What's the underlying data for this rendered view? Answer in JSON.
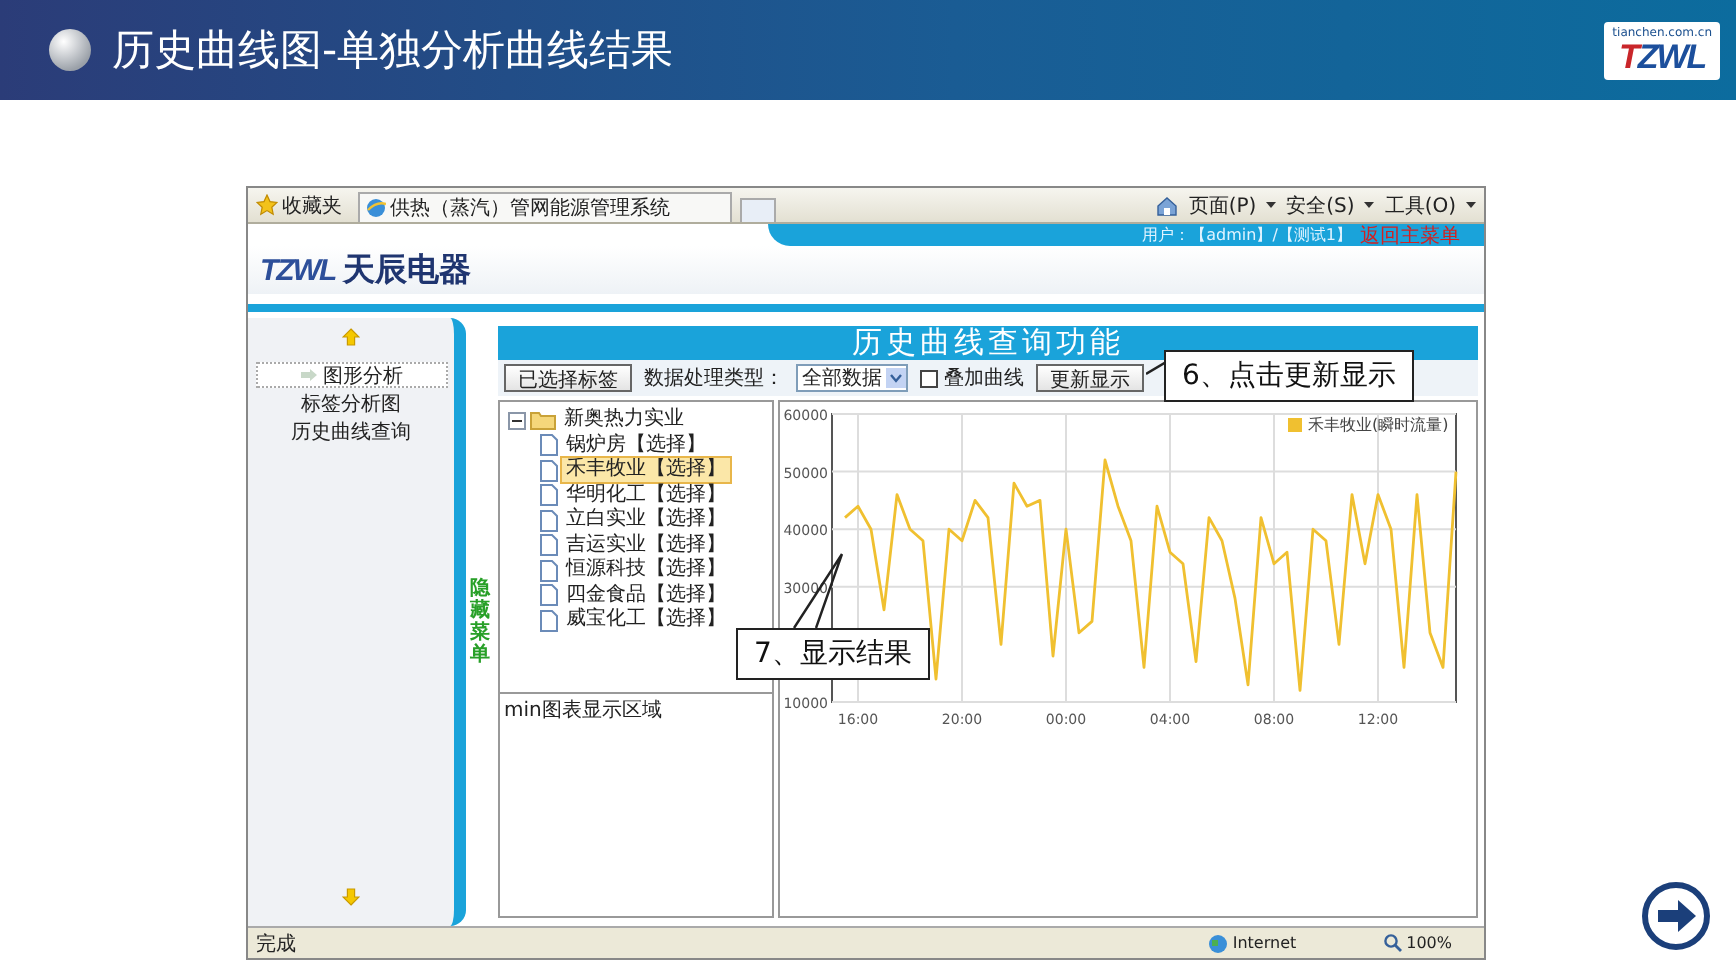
{
  "slide": {
    "title": "历史曲线图-单独分析曲线结果",
    "logo": "TZWL",
    "logo_site": "tianchen.com.cn"
  },
  "browser": {
    "favorites": "收藏夹",
    "tab_title": "供热（蒸汽）管网能源管理系统",
    "menus": [
      "页面(P)",
      "安全(S)",
      "工具(O)"
    ],
    "status": "完成",
    "zone": "Internet",
    "zoom": "100%"
  },
  "app": {
    "logo_mark": "TZWL",
    "brand": "天辰电器",
    "user": "用户：【admin】/【测试1】",
    "return_link": "返回主菜单",
    "sidebar": {
      "items": [
        {
          "label": "图形分析",
          "selected": true
        },
        {
          "label": "标签分析图",
          "selected": false
        },
        {
          "label": "历史曲线查询",
          "selected": false
        }
      ],
      "hide_menu": "隐藏菜单"
    },
    "panel_title": "历史曲线查询功能",
    "toolbar": {
      "tag_button": "已选择标签",
      "type_label": "数据处理类型：",
      "type_value": "全部数据",
      "overlay": {
        "label": "叠加曲线",
        "checked": false
      },
      "update_button": "更新显示"
    },
    "tree": {
      "label": "新奥热力实业",
      "expanded": true,
      "children": [
        {
          "label": "锅炉房【选择】",
          "selected": false
        },
        {
          "label": "禾丰牧业【选择】",
          "selected": true
        },
        {
          "label": "华明化工【选择】",
          "selected": false
        },
        {
          "label": "立白实业【选择】",
          "selected": false
        },
        {
          "label": "吉运实业【选择】",
          "selected": false
        },
        {
          "label": "恒源科技【选择】",
          "selected": false
        },
        {
          "label": "四金食品【选择】",
          "selected": false
        },
        {
          "label": "威宝化工【选择】",
          "selected": false
        }
      ]
    },
    "mini_area": "min图表显示区域",
    "chart": {
      "chart_data": {
        "type": "line",
        "categories": [
          null,
          null,
          "16:00",
          null,
          null,
          null,
          null,
          null,
          null,
          null,
          "20:00",
          null,
          null,
          null,
          null,
          null,
          null,
          null,
          "00:00",
          null,
          null,
          null,
          null,
          null,
          null,
          null,
          "04:00",
          null,
          null,
          null,
          null,
          null,
          null,
          null,
          "08:00",
          null,
          null,
          null,
          null,
          null,
          null,
          null,
          "12:00",
          null,
          null,
          null,
          null,
          null,
          null
        ],
        "series": [
          {
            "name": "禾丰牧业(瞬时流量)",
            "color": "#f0c030",
            "values": [
              null,
              42000,
              44000,
              40000,
              26000,
              46000,
              40000,
              38000,
              14000,
              40000,
              38000,
              45000,
              42000,
              20000,
              48000,
              44000,
              45000,
              18000,
              40000,
              22000,
              24000,
              52000,
              44000,
              38000,
              16000,
              44000,
              36000,
              34000,
              17000,
              42000,
              38000,
              28000,
              13000,
              42000,
              34000,
              36000,
              12000,
              40000,
              38000,
              20000,
              46000,
              34000,
              46000,
              40000,
              16000,
              46000,
              22000,
              16000,
              50000
            ]
          }
        ],
        "ylim": [
          10000,
          60000
        ],
        "grid": true,
        "yticks": [
          10000,
          30000,
          40000,
          50000,
          60000
        ]
      }
    }
  },
  "callouts": [
    {
      "text": "6、点击更新显示"
    },
    {
      "text": "7、显示结果"
    }
  ]
}
